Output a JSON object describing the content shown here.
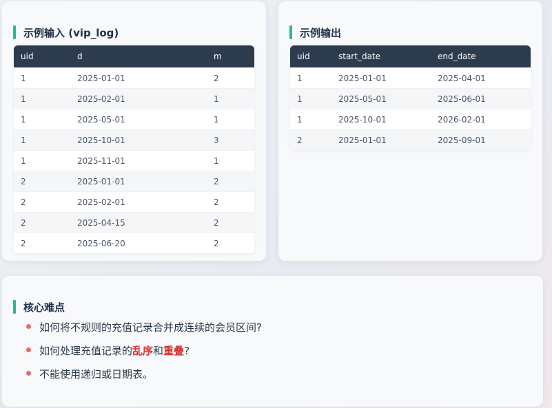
{
  "input_card": {
    "title": "示例输入 (vip_log)",
    "columns": [
      "uid",
      "d",
      "m"
    ],
    "rows": [
      [
        "1",
        "2025-01-01",
        "2"
      ],
      [
        "1",
        "2025-02-01",
        "1"
      ],
      [
        "1",
        "2025-05-01",
        "1"
      ],
      [
        "1",
        "2025-10-01",
        "3"
      ],
      [
        "1",
        "2025-11-01",
        "1"
      ],
      [
        "2",
        "2025-01-01",
        "2"
      ],
      [
        "2",
        "2025-02-01",
        "2"
      ],
      [
        "2",
        "2025-04-15",
        "2"
      ],
      [
        "2",
        "2025-06-20",
        "2"
      ]
    ]
  },
  "output_card": {
    "title": "示例输出",
    "columns": [
      "uid",
      "start_date",
      "end_date"
    ],
    "rows": [
      [
        "1",
        "2025-01-01",
        "2025-04-01"
      ],
      [
        "1",
        "2025-05-01",
        "2025-06-01"
      ],
      [
        "1",
        "2025-10-01",
        "2026-02-01"
      ],
      [
        "2",
        "2025-01-01",
        "2025-09-01"
      ]
    ]
  },
  "difficulty_card": {
    "title": "核心难点",
    "points": [
      {
        "text": "如何将不规则的充值记录合并成连续的会员区间?"
      },
      {
        "prefix": "如何处理充值记录的",
        "hl1": "乱序",
        "mid": "和",
        "hl2": "重叠",
        "suffix": "?"
      },
      {
        "text": "不能使用递归或日期表。"
      }
    ]
  },
  "colors": {
    "accent_bar": "#27b8a0",
    "table_header": "#2d3b4f",
    "bullet": "#e36b6b",
    "highlight": "#d93030"
  }
}
